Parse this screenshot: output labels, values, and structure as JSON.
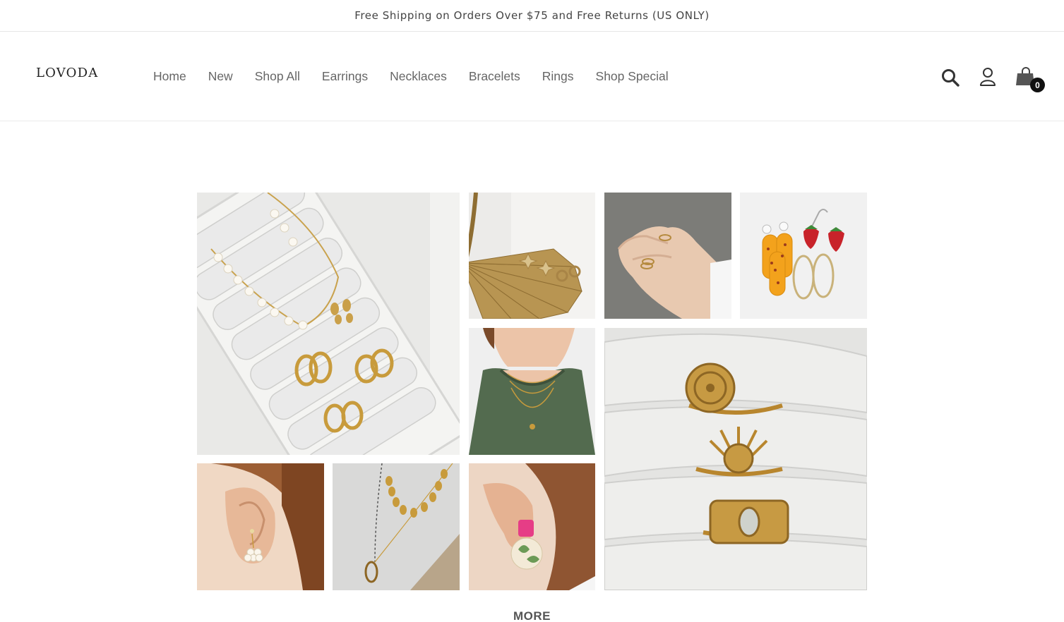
{
  "announcement": "Free Shipping on Orders Over $75 and Free Returns (US ONLY)",
  "brand": {
    "logo_text": "LOVODA"
  },
  "nav": {
    "items": [
      "Home",
      "New",
      "Shop All",
      "Earrings",
      "Necklaces",
      "Bracelets",
      "Rings",
      "Shop Special"
    ]
  },
  "header_icons": {
    "search": "search-icon",
    "account": "account-icon",
    "cart": "shopping-bag-icon"
  },
  "cart": {
    "count": "0"
  },
  "gallery": {
    "tiles": [
      "jewelry-tray-photo",
      "palm-leaf-earrings-photo",
      "hand-rings-photo",
      "fruit-earrings-photo",
      "layered-necklace-photo",
      "gold-rings-photo",
      "pearl-drop-earring-photo",
      "chain-necklace-photo",
      "leaf-disc-earring-photo"
    ]
  },
  "more_label": "MORE",
  "colors": {
    "text": "#333333",
    "nav": "#666666",
    "badge": "#111111"
  }
}
